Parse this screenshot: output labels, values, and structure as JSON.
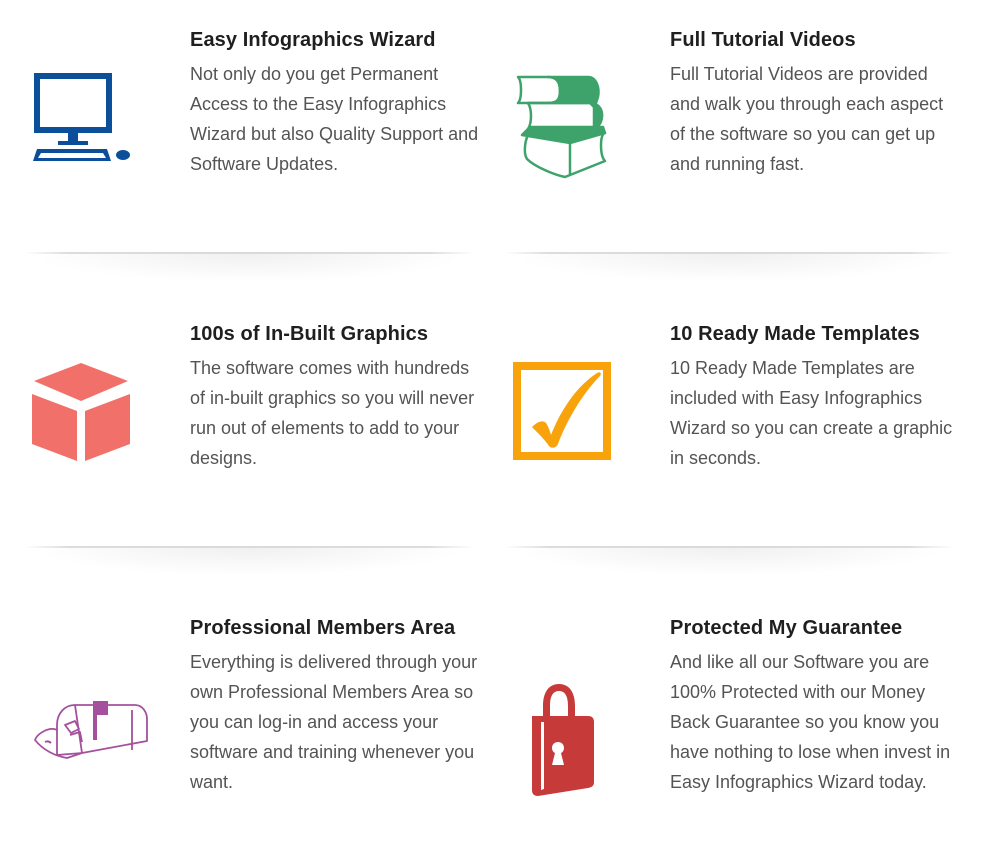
{
  "features": [
    {
      "icon": "computer-icon",
      "color": "#0b4f9a",
      "title": "Easy Infographics Wizard",
      "description": "Not only do you get Permanent Access to the Easy Infographics Wizard but also Quality Support and Software Updates."
    },
    {
      "icon": "books-icon",
      "color": "#3ea36b",
      "title": "Full Tutorial Videos",
      "description": "Full Tutorial Videos are provided and walk you through each aspect of the software so you can get up and running fast."
    },
    {
      "icon": "cube-icon",
      "color": "#f2706a",
      "title": "100s of In-Built Graphics",
      "description": "The software comes with hundreds of in-built graphics so you will never run out of elements to add to your designs."
    },
    {
      "icon": "checkbox-icon",
      "color": "#f8a20c",
      "title": "10 Ready Made Templates",
      "description": "10 Ready Made Templates are included with Easy Infographics Wizard so you can create a graphic in seconds."
    },
    {
      "icon": "mailbox-icon",
      "color": "#a5509c",
      "title": "Professional Members Area",
      "description": "Everything is delivered through your own Professional Members Area so you can log-in and access your software and training whenever you want."
    },
    {
      "icon": "padlock-icon",
      "color": "#c73a3a",
      "title": "Protected My Guarantee",
      "description": "And like all our Software you are 100% Protected with our Money Back Guarantee so you know you have nothing to lose when invest in Easy Infographics Wizard today."
    }
  ]
}
